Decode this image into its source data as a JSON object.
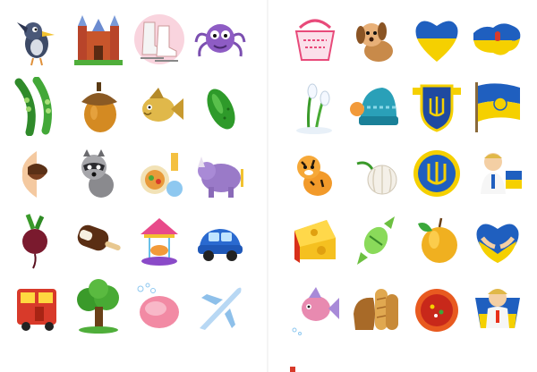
{
  "sheets": [
    {
      "name": "left",
      "icons": [
        "cartoon-bird-icon",
        "castle-icon",
        "ice-skates-icon",
        "spider-icon",
        "pea-pods-icon",
        "acorn-icon",
        "fish-icon",
        "cucumber-icon",
        "lips-icon",
        "raccoon-icon",
        "meal-tray-icon",
        "rhinoceros-icon",
        "beet-icon",
        "ice-cream-bar-icon",
        "carousel-icon",
        "toy-car-icon",
        "bus-icon",
        "oak-tree-icon",
        "soap-icon",
        "airplane-icon"
      ]
    },
    {
      "name": "right",
      "icons": [
        "embroidered-bag-icon",
        "puppy-icon",
        "flag-heart-icon",
        "map-of-ukraine-icon",
        "snowdrop-icon",
        "knit-hat-icon",
        "trident-shield-icon",
        "ukrainian-flag-icon",
        "tiger-cub-icon",
        "garlic-icon",
        "trident-medal-icon",
        "boy-in-vyshyvanka-icon",
        "cheese-icon",
        "candy-icon",
        "apple-icon",
        "flag-hands-heart-icon",
        "fish-toy-icon",
        "bread-loaves-icon",
        "borscht-icon",
        "girl-in-vyshyvanka-icon"
      ]
    }
  ],
  "colors": {
    "ukraine_blue": "#1f5fbf",
    "ukraine_yellow": "#f5d000",
    "leaf_green": "#3aa83a"
  }
}
